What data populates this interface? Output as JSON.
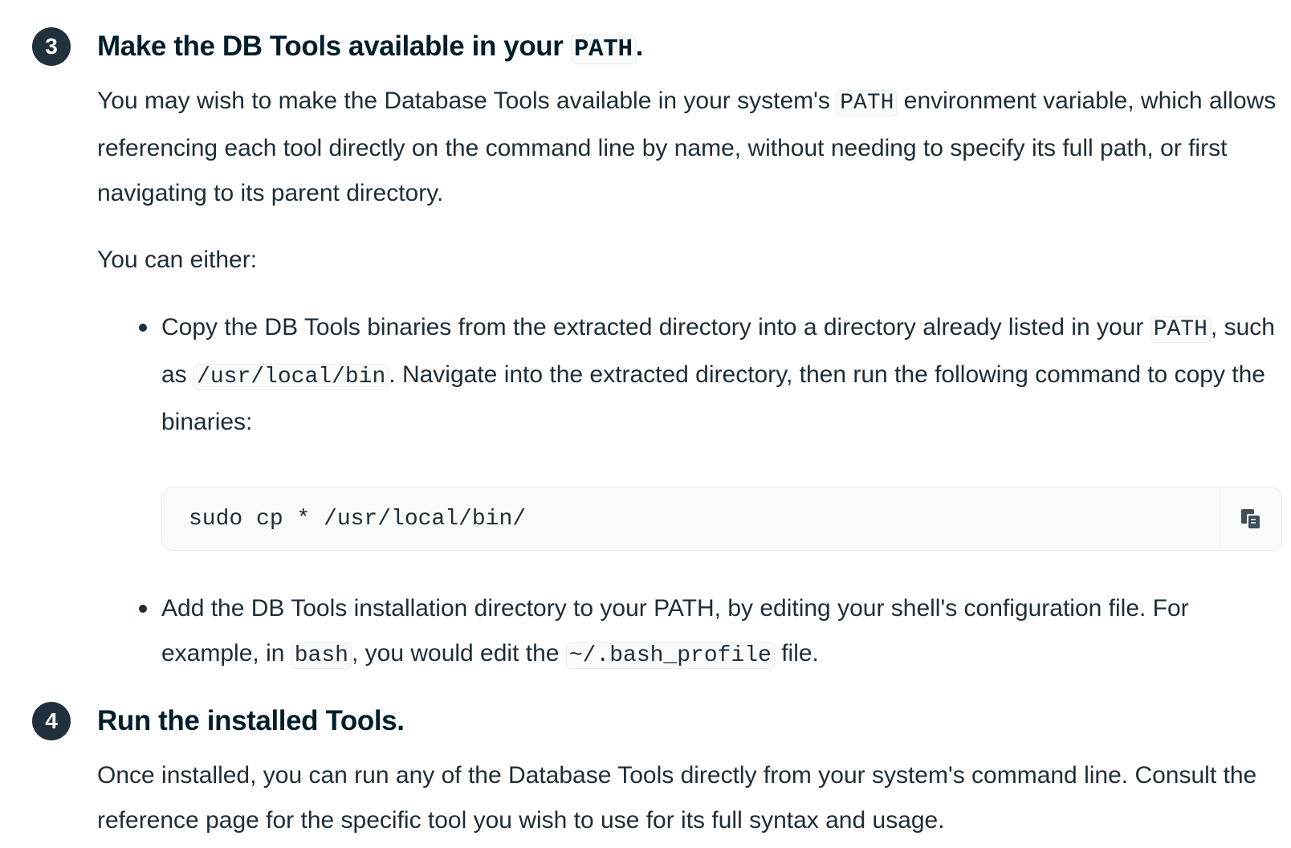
{
  "steps": [
    {
      "number": "3",
      "title_prefix": "Make the DB Tools available in your ",
      "title_code": "PATH",
      "title_suffix": ".",
      "intro": {
        "text1": "You may wish to make the Database Tools available in your system's ",
        "code1": "PATH",
        "text2": " environment variable, which allows referencing each tool directly on the command line by name, without needing to specify its full path, or first navigating to its parent directory."
      },
      "either": "You can either:",
      "bullets": [
        {
          "text1": "Copy the DB Tools binaries from the extracted directory into a directory already listed in your ",
          "code1": "PATH",
          "text2": ", such as ",
          "code2": "/usr/local/bin",
          "text3": ". Navigate into the extracted directory, then run the following command to copy the binaries:"
        },
        {
          "text1": "Add the DB Tools installation directory to your PATH, by editing your shell's configuration file. For example, in ",
          "code1": "bash",
          "text2": ", you would edit the ",
          "code2": "~/.bash_profile",
          "text3": " file."
        }
      ],
      "code_block": {
        "command": "sudo cp * /usr/local/bin/",
        "copy_icon": "copy-icon"
      }
    },
    {
      "number": "4",
      "title": "Run the installed Tools.",
      "body": "Once installed, you can run any of the Database Tools directly from your system's command line. Consult the reference page for the specific tool you wish to use for its full syntax and usage."
    }
  ]
}
